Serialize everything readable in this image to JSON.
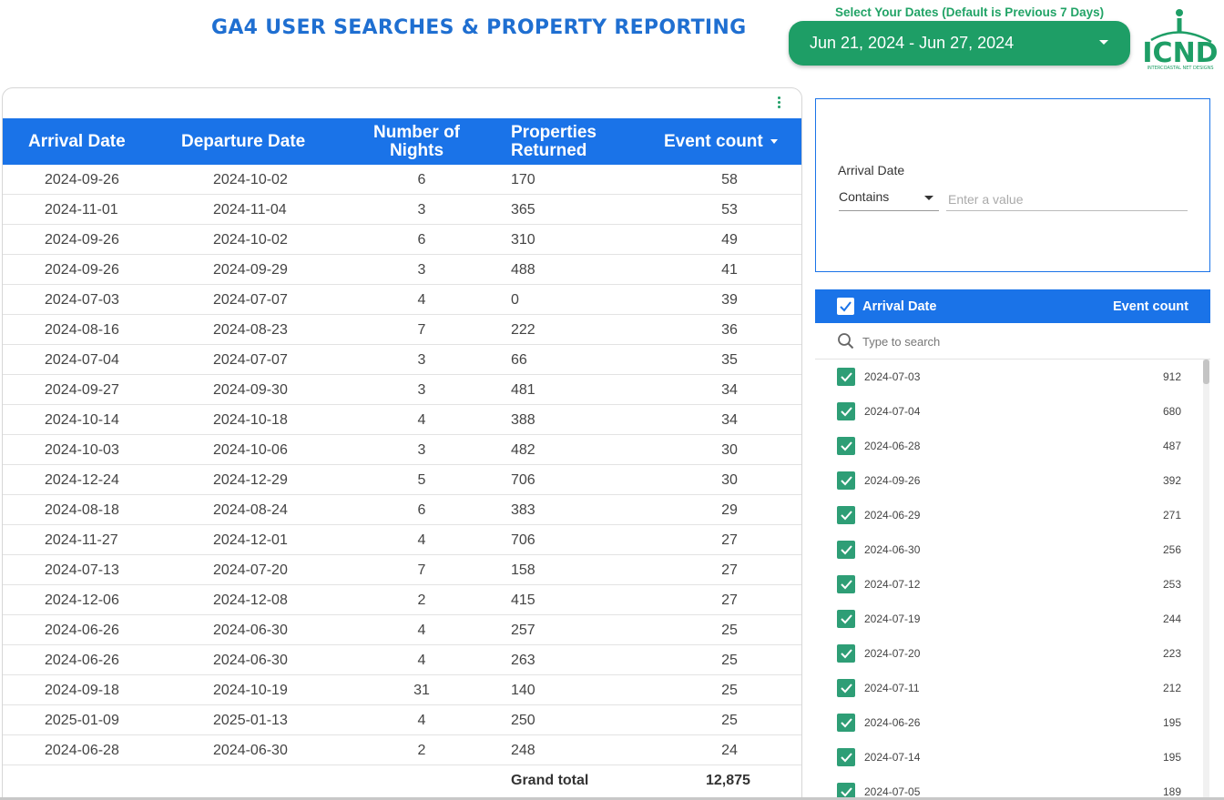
{
  "header": {
    "title": "GA4 USER SEARCHES & PROPERTY REPORTING",
    "date_label": "Select Your Dates (Default is Previous 7 Days)",
    "date_range": "Jun 21, 2024 - Jun 27, 2024",
    "logo_text": "ICND",
    "logo_subtext": "INTERCOASTAL NET DESIGNS"
  },
  "colors": {
    "title": "#1f6fd1",
    "accent_green": "#1e9e66",
    "header_blue": "#1a73e8",
    "checkbox_green": "#2e9e76"
  },
  "table": {
    "columns": [
      "Arrival Date",
      "Departure Date",
      "Number of",
      "Nights",
      "Properties",
      "Returned",
      "Event count"
    ],
    "rows": [
      [
        "2024-09-26",
        "2024-10-02",
        "6",
        "170",
        "58"
      ],
      [
        "2024-11-01",
        "2024-11-04",
        "3",
        "365",
        "53"
      ],
      [
        "2024-09-26",
        "2024-10-02",
        "6",
        "310",
        "49"
      ],
      [
        "2024-09-26",
        "2024-09-29",
        "3",
        "488",
        "41"
      ],
      [
        "2024-07-03",
        "2024-07-07",
        "4",
        "0",
        "39"
      ],
      [
        "2024-08-16",
        "2024-08-23",
        "7",
        "222",
        "36"
      ],
      [
        "2024-07-04",
        "2024-07-07",
        "3",
        "66",
        "35"
      ],
      [
        "2024-09-27",
        "2024-09-30",
        "3",
        "481",
        "34"
      ],
      [
        "2024-10-14",
        "2024-10-18",
        "4",
        "388",
        "34"
      ],
      [
        "2024-10-03",
        "2024-10-06",
        "3",
        "482",
        "30"
      ],
      [
        "2024-12-24",
        "2024-12-29",
        "5",
        "706",
        "30"
      ],
      [
        "2024-08-18",
        "2024-08-24",
        "6",
        "383",
        "29"
      ],
      [
        "2024-11-27",
        "2024-12-01",
        "4",
        "706",
        "27"
      ],
      [
        "2024-07-13",
        "2024-07-20",
        "7",
        "158",
        "27"
      ],
      [
        "2024-12-06",
        "2024-12-08",
        "2",
        "415",
        "27"
      ],
      [
        "2024-06-26",
        "2024-06-30",
        "4",
        "257",
        "25"
      ],
      [
        "2024-06-26",
        "2024-06-30",
        "4",
        "263",
        "25"
      ],
      [
        "2024-09-18",
        "2024-10-19",
        "31",
        "140",
        "25"
      ],
      [
        "2025-01-09",
        "2025-01-13",
        "4",
        "250",
        "25"
      ],
      [
        "2024-06-28",
        "2024-06-30",
        "2",
        "248",
        "24"
      ]
    ],
    "grand_total_label": "Grand total",
    "grand_total_value": "12,875"
  },
  "filter": {
    "label": "Arrival Date",
    "operator": "Contains",
    "placeholder": "Enter a value"
  },
  "list": {
    "header_label": "Arrival Date",
    "header_count": "Event count",
    "search_placeholder": "Type to search",
    "items": [
      [
        "2024-07-03",
        "912"
      ],
      [
        "2024-07-04",
        "680"
      ],
      [
        "2024-06-28",
        "487"
      ],
      [
        "2024-09-26",
        "392"
      ],
      [
        "2024-06-29",
        "271"
      ],
      [
        "2024-06-30",
        "256"
      ],
      [
        "2024-07-12",
        "253"
      ],
      [
        "2024-07-19",
        "244"
      ],
      [
        "2024-07-20",
        "223"
      ],
      [
        "2024-07-11",
        "212"
      ],
      [
        "2024-06-26",
        "195"
      ],
      [
        "2024-07-14",
        "195"
      ],
      [
        "2024-07-05",
        "189"
      ]
    ]
  }
}
